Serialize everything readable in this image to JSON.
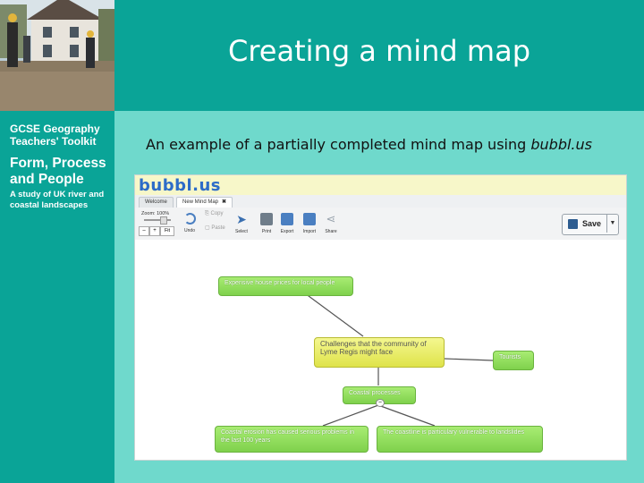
{
  "sidebar": {
    "toolkit_title": "GCSE Geography Teachers' Toolkit",
    "unit_title": "Form, Process and People",
    "unit_subtitle": "A study of UK river and coastal landscapes"
  },
  "slide": {
    "title": "Creating a mind map",
    "caption_prefix": "An example of a partially completed mind map using ",
    "caption_site": "bubbl.us"
  },
  "app": {
    "logo": "bubbl.us",
    "tabs": [
      {
        "label": "Welcome"
      },
      {
        "label": "New Mind Map",
        "close": "✖"
      }
    ],
    "zoom": {
      "label": "Zoom: 100%",
      "minus": "–",
      "plus": "+",
      "fit": "Fit"
    },
    "toolbar": [
      {
        "label": "Undo",
        "icon": "undo-icon",
        "color": "#4a7fc1"
      },
      {
        "label": "Select",
        "icon": "cursor-icon",
        "color": "#3a6fb0"
      },
      {
        "label": "Print",
        "icon": "printer-icon",
        "color": "#6f7d8a"
      },
      {
        "label": "Export",
        "icon": "export-icon",
        "color": "#4a7fc1"
      },
      {
        "label": "Import",
        "icon": "import-icon",
        "color": "#4a7fc1"
      },
      {
        "label": "Share",
        "icon": "share-icon",
        "color": "#9aa4ae"
      }
    ],
    "copy_label": "Copy",
    "paste_label": "Paste",
    "save_label": "Save",
    "nodes": [
      {
        "key": "house_prices",
        "text": "Expensive house prices for local people"
      },
      {
        "key": "challenges",
        "text": "Challenges that the community of Lyme Regis might face"
      },
      {
        "key": "tourists",
        "text": "Tourists"
      },
      {
        "key": "coastal",
        "text": "Coastal processes"
      },
      {
        "key": "erosion",
        "text": "Coastal erosion has caused serious problems in the last 100 years"
      },
      {
        "key": "landslides",
        "text": "The coastline is particulary vulnerable to landslides"
      }
    ],
    "handle_symbol": "–"
  }
}
